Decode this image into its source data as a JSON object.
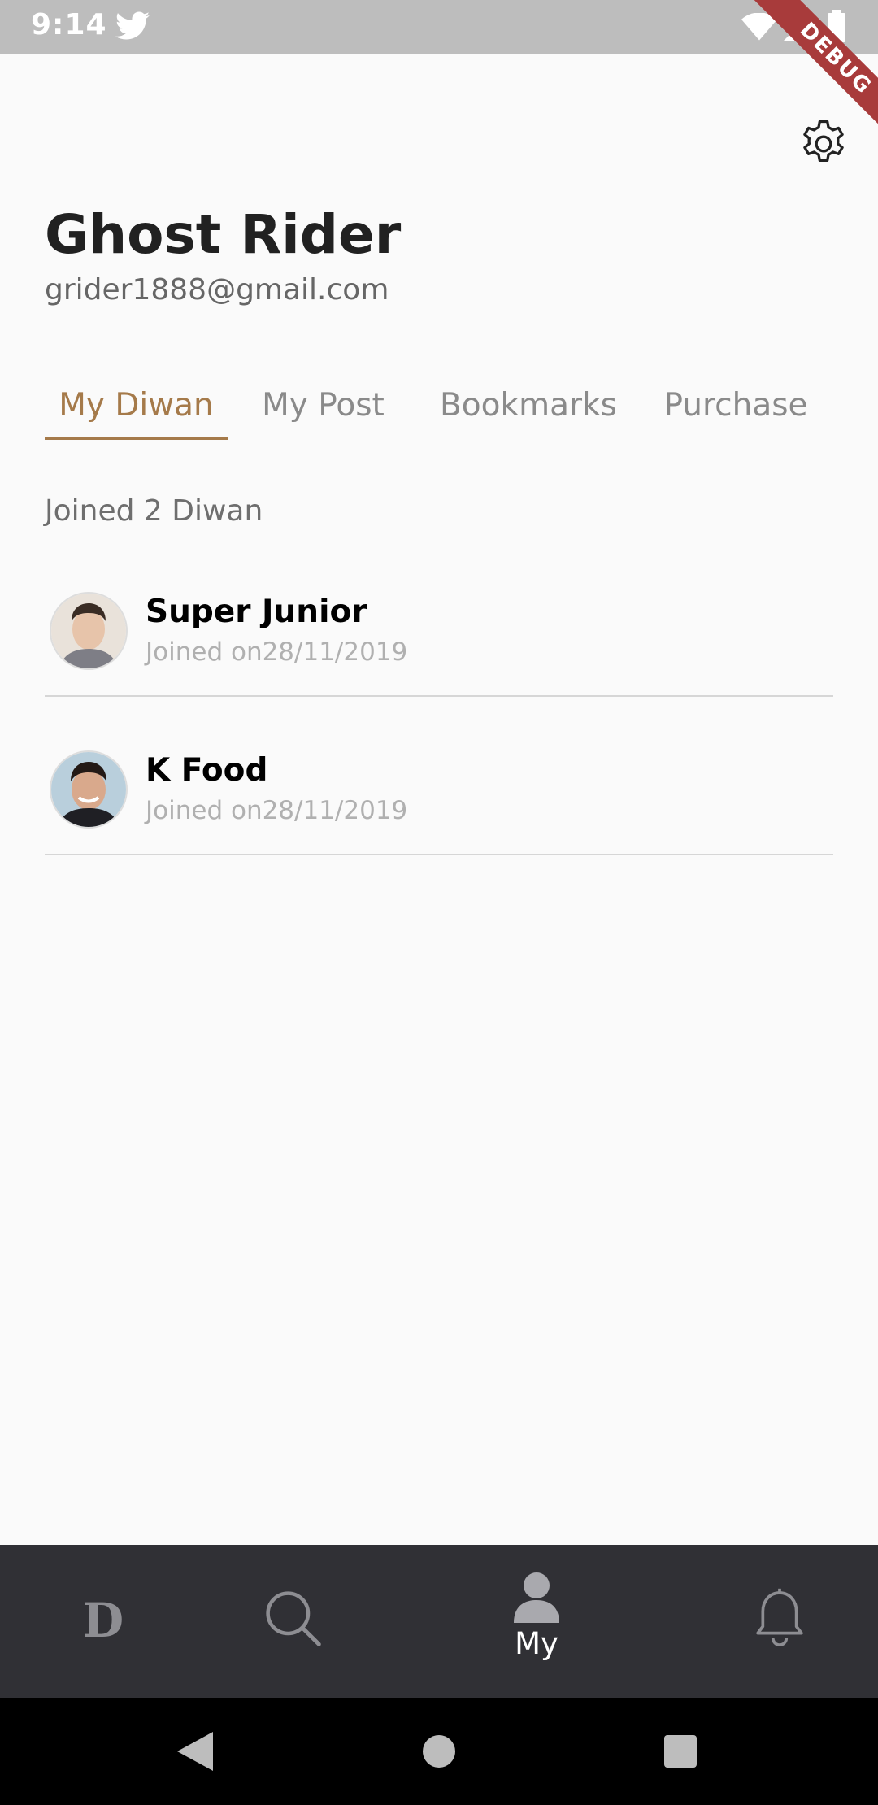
{
  "status_bar": {
    "time": "9:14",
    "debug_label": "DEBUG",
    "icons": [
      "twitter-icon",
      "wifi-icon",
      "signal-icon",
      "battery-icon"
    ]
  },
  "profile": {
    "name": "Ghost Rider",
    "email": "grider1888@gmail.com"
  },
  "tabs": [
    {
      "label": "My Diwan",
      "active": true
    },
    {
      "label": "My Post",
      "active": false
    },
    {
      "label": "Bookmarks",
      "active": false
    },
    {
      "label": "Purchase",
      "active": false
    }
  ],
  "joined_summary": "Joined 2 Diwan",
  "diwans": [
    {
      "title": "Super Junior",
      "joined": "Joined on28/11/2019"
    },
    {
      "title": "K Food",
      "joined": "Joined on28/11/2019"
    }
  ],
  "bottom_nav": {
    "items": [
      {
        "icon": "diwan-logo-icon",
        "label": ""
      },
      {
        "icon": "search-icon",
        "label": ""
      },
      {
        "icon": "person-icon",
        "label": "My",
        "active": true
      },
      {
        "icon": "bell-icon",
        "label": ""
      }
    ]
  },
  "colors": {
    "accent": "#a57a4a",
    "nav_background": "#303035",
    "status_bar": "#bdbdbd",
    "debug_ribbon": "#a83b3b"
  }
}
